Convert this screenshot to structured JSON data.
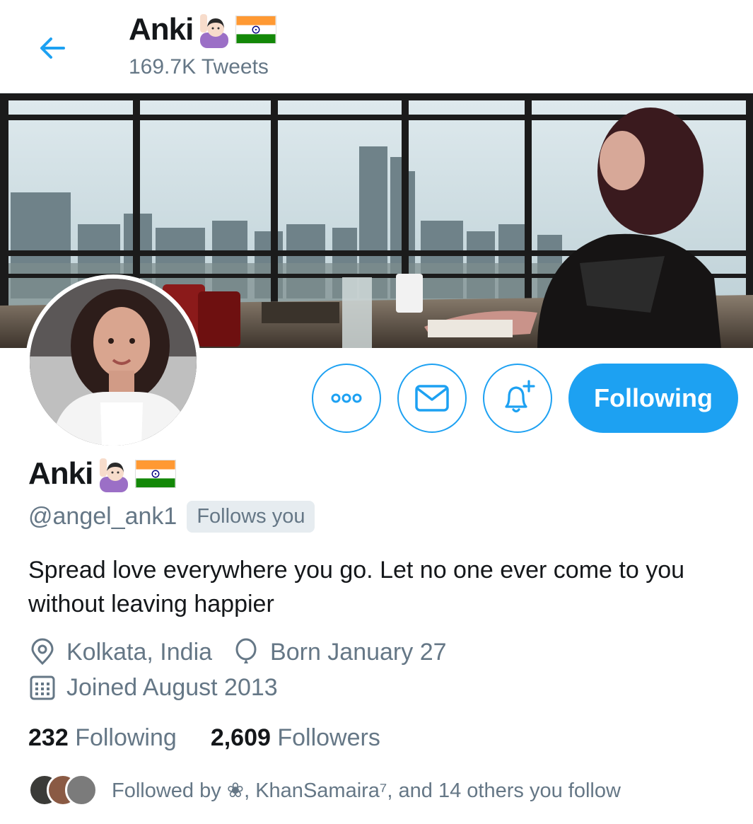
{
  "header": {
    "name": "Anki",
    "tweets_count": "169.7K Tweets"
  },
  "icons": {
    "back": "back-arrow-icon",
    "more": "more-options-icon",
    "message": "envelope-icon",
    "notify": "bell-plus-icon",
    "location": "location-pin-icon",
    "birthday": "balloon-icon",
    "joined": "calendar-icon",
    "emoji": "person-raising-hand-emoji",
    "flag": "india-flag-emoji"
  },
  "profile": {
    "name": "Anki",
    "handle": "@angel_ank1",
    "follows_you": "Follows you",
    "bio": "Spread love everywhere you go. Let no one ever come to you without leaving happier",
    "location": "Kolkata, India",
    "birthday": "Born January 27",
    "joined": "Joined August 2013"
  },
  "actions": {
    "following_label": "Following"
  },
  "stats": {
    "following_count": "232",
    "following_label": "Following",
    "followers_count": "2,609",
    "followers_label": "Followers"
  },
  "followed_by": {
    "text": "Followed by ❀, KhanSamaira⁷, and 14 others you follow"
  },
  "colors": {
    "accent": "#1da1f2",
    "secondary_text": "#657786",
    "primary_text": "#14171a"
  }
}
